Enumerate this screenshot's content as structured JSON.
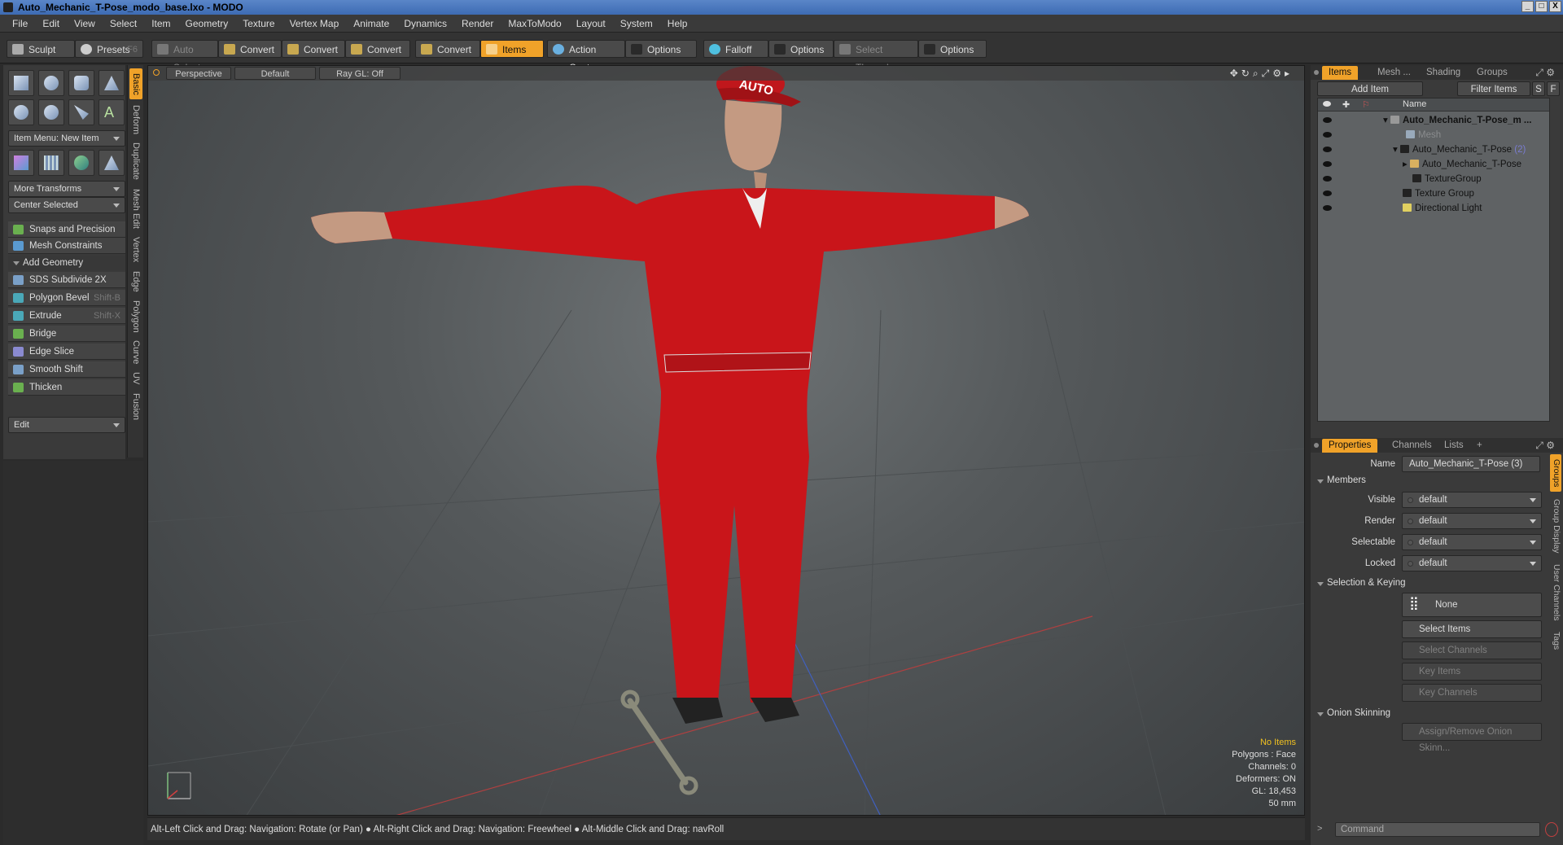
{
  "window": {
    "title": "Auto_Mechanic_T-Pose_modo_base.lxo - MODO",
    "controls": [
      "_",
      "□",
      "X"
    ]
  },
  "menu": [
    "File",
    "Edit",
    "Select",
    "View",
    "Item",
    "Geometry",
    "Texture",
    "Vertex Map",
    "Animate",
    "Dynamics",
    "Render",
    "MaxToModo",
    "Layout",
    "System",
    "Help"
  ],
  "toolbar": {
    "sculpt": "Sculpt",
    "presets": "Presets",
    "presets_hotkey": "F6",
    "auto_select": "Auto Select",
    "convert1": "Convert",
    "convert2": "Convert",
    "convert3": "Convert",
    "convert4": "Convert",
    "items": "Items",
    "action_center": "Action Center",
    "options1": "Options",
    "falloff": "Falloff",
    "options2": "Options",
    "select_through": "Select Through",
    "options3": "Options"
  },
  "left": {
    "item_menu": "Item Menu: New Item",
    "more_transforms": "More Transforms",
    "center_selected": "Center Selected",
    "snaps": "Snaps and Precision",
    "mesh_constraints": "Mesh Constraints",
    "add_geometry": "Add Geometry",
    "tools": [
      {
        "label": "SDS Subdivide 2X",
        "hotkey": ""
      },
      {
        "label": "Polygon Bevel",
        "hotkey": "Shift-B"
      },
      {
        "label": "Extrude",
        "hotkey": "Shift-X"
      },
      {
        "label": "Bridge",
        "hotkey": ""
      },
      {
        "label": "Edge Slice",
        "hotkey": ""
      },
      {
        "label": "Smooth Shift",
        "hotkey": ""
      },
      {
        "label": "Thicken",
        "hotkey": ""
      }
    ],
    "edit": "Edit",
    "tabs": [
      "Basic",
      "Deform",
      "Duplicate",
      "Mesh Edit",
      "Vertex",
      "Edge",
      "Polygon",
      "Curve",
      "UV",
      "Fusion"
    ]
  },
  "viewport": {
    "perspective": "Perspective",
    "default": "Default",
    "raygl": "Ray GL: Off",
    "info": {
      "no_items": "No Items",
      "polygons": "Polygons : Face",
      "channels": "Channels: 0",
      "deformers": "Deformers: ON",
      "gl": "GL: 18,453",
      "focal": "50 mm"
    }
  },
  "status": "Alt-Left Click and Drag: Navigation: Rotate (or Pan) ● Alt-Right Click and Drag: Navigation: Freewheel ● Alt-Middle Click and Drag: navRoll",
  "items_panel": {
    "tabs": [
      "Items",
      "Mesh ...",
      "Shading",
      "Groups"
    ],
    "add_item": "Add Item",
    "filter_items": "Filter Items",
    "s": "S",
    "f": "F",
    "name_header": "Name",
    "tree": [
      {
        "label": "Auto_Mechanic_T-Pose_m ...",
        "count": ""
      },
      {
        "label": "Mesh",
        "count": ""
      },
      {
        "label": "Auto_Mechanic_T-Pose",
        "count": "(2)"
      },
      {
        "label": "Auto_Mechanic_T-Pose",
        "count": ""
      },
      {
        "label": "TextureGroup",
        "count": ""
      },
      {
        "label": "Texture Group",
        "count": ""
      },
      {
        "label": "Directional Light",
        "count": ""
      }
    ]
  },
  "properties": {
    "tabs": [
      "Properties",
      "Channels",
      "Lists",
      "+"
    ],
    "name_label": "Name",
    "name_value": "Auto_Mechanic_T-Pose (3)",
    "members": "Members",
    "rows": [
      {
        "label": "Visible",
        "value": "default"
      },
      {
        "label": "Render",
        "value": "default"
      },
      {
        "label": "Selectable",
        "value": "default"
      },
      {
        "label": "Locked",
        "value": "default"
      }
    ],
    "selection_keying": "Selection & Keying",
    "none": "None",
    "select_items": "Select Items",
    "select_channels": "Select Channels",
    "key_items": "Key Items",
    "key_channels": "Key Channels",
    "onion_skinning": "Onion Skinning",
    "assign_onion": "Assign/Remove Onion Skinn...",
    "side_tabs": [
      "Groups",
      "Group Display",
      "User Channels",
      "Tags"
    ],
    "command_placeholder": "Command"
  }
}
